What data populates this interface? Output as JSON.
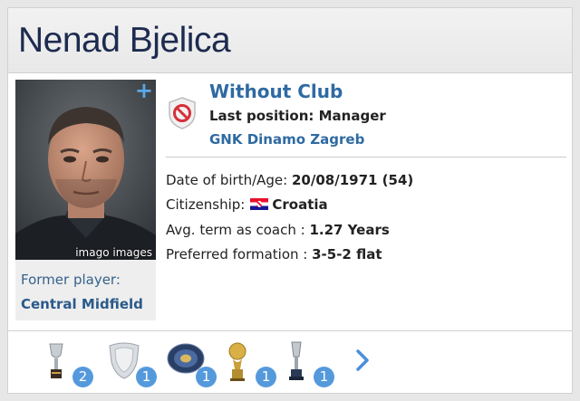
{
  "header": {
    "name": "Nenad Bjelica"
  },
  "photo": {
    "credit": "imago images",
    "add_label": "+"
  },
  "former": {
    "label": "Former player:",
    "position": "Central Midfield"
  },
  "club": {
    "status": "Without Club",
    "last_position": "Last position: Manager",
    "last_club": "GNK Dinamo Zagreb"
  },
  "info": {
    "dob_label": "Date of birth/Age: ",
    "dob_value": "20/08/1971 (54)",
    "citizenship_label": "Citizenship:",
    "citizenship_value": "Croatia",
    "term_label": "Avg. term as coach : ",
    "term_value": "1.27 Years",
    "formation_label": "Preferred formation : ",
    "formation_value": "3-5-2 flat"
  },
  "trophies": [
    {
      "icon": "cup-trophy-icon",
      "count": "2"
    },
    {
      "icon": "shield-trophy-icon",
      "count": "1"
    },
    {
      "icon": "plate-trophy-icon",
      "count": "1"
    },
    {
      "icon": "golden-ball-trophy-icon",
      "count": "1"
    },
    {
      "icon": "silver-cup-trophy-icon",
      "count": "1"
    }
  ],
  "colors": {
    "accent": "#2e6aa2",
    "badge": "#5599dd",
    "title": "#1d2b4f"
  }
}
